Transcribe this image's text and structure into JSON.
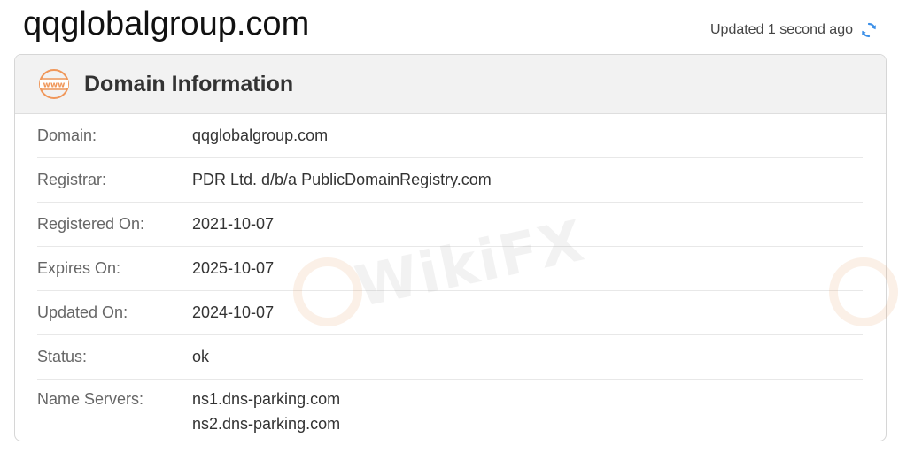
{
  "page": {
    "domain": "qqglobalgroup.com",
    "updated_text": "Updated 1 second ago"
  },
  "card": {
    "title": "Domain Information",
    "icon_text": "www"
  },
  "rows": [
    {
      "label": "Domain:",
      "value": "qqglobalgroup.com"
    },
    {
      "label": "Registrar:",
      "value": "PDR Ltd. d/b/a PublicDomainRegistry.com"
    },
    {
      "label": "Registered On:",
      "value": "2021-10-07"
    },
    {
      "label": "Expires On:",
      "value": "2025-10-07"
    },
    {
      "label": "Updated On:",
      "value": "2024-10-07"
    },
    {
      "label": "Status:",
      "value": "ok"
    }
  ],
  "name_servers": {
    "label": "Name Servers:",
    "values": [
      "ns1.dns-parking.com",
      "ns2.dns-parking.com"
    ]
  },
  "watermark": {
    "text": "WikiFX"
  },
  "colors": {
    "accent_orange": "#f0975a",
    "refresh_blue": "#3b8fe8"
  },
  "icons": {
    "refresh": "refresh-icon",
    "www": "www-icon"
  }
}
